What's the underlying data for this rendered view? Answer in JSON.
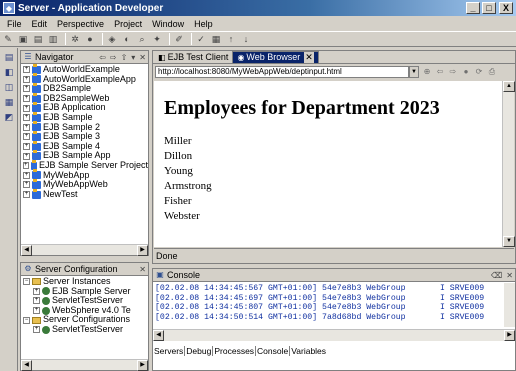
{
  "window": {
    "title": "Server - Application Developer",
    "minimize": "_",
    "maximize": "□",
    "close": "X"
  },
  "menu": [
    "File",
    "Edit",
    "Perspective",
    "Project",
    "Window",
    "Help"
  ],
  "navigator": {
    "title": "Navigator",
    "items": [
      "AutoWorldExample",
      "AutoWorldExampleApp",
      "DB2Sample",
      "DB2SampleWeb",
      "EJB Application",
      "EJB Sample",
      "EJB Sample 2",
      "EJB Sample 3",
      "EJB Sample 4",
      "EJB Sample App",
      "EJB Sample Server Project",
      "MyWebApp",
      "MyWebAppWeb",
      "NewTest"
    ]
  },
  "editor": {
    "tabs": [
      {
        "label": "EJB Test Client"
      },
      {
        "label": "Web Browser"
      }
    ],
    "url": "http://localhost:8080/MyWebAppWeb/deptinput.html",
    "heading": "Employees for Department 2023",
    "employees": [
      "Miller",
      "Dillon",
      "Young",
      "Armstrong",
      "Fisher",
      "Webster"
    ],
    "status": "Done"
  },
  "server_config": {
    "title": "Server Configuration",
    "items": [
      {
        "label": "Server Instances",
        "level": 0
      },
      {
        "label": "EJB Sample Server",
        "level": 1
      },
      {
        "label": "ServletTestServer",
        "level": 1
      },
      {
        "label": "WebSphere v4.0 Te",
        "level": 1
      },
      {
        "label": "Server Configurations",
        "level": 0
      },
      {
        "label": "ServletTestServer",
        "level": 1
      }
    ]
  },
  "console": {
    "title": "Console",
    "lines": [
      "[02.02.08 14:34:45:567 GMT+01:00] 54e7e8b3 WebGroup       I SRVE009",
      "[02.02.08 14:34:45:697 GMT+01:00] 54e7e8b3 WebGroup       I SRVE009",
      "[02.02.08 14:34:45:807 GMT+01:00] 54e7e8b3 WebGroup       I SRVE009",
      "[02.02.08 14:34:50:514 GMT+01:00] 7a8d68bd WebGroup       I SRVE009"
    ],
    "bottom_tabs": [
      "Servers",
      "Debug",
      "Processes",
      "Console",
      "Variables"
    ]
  }
}
